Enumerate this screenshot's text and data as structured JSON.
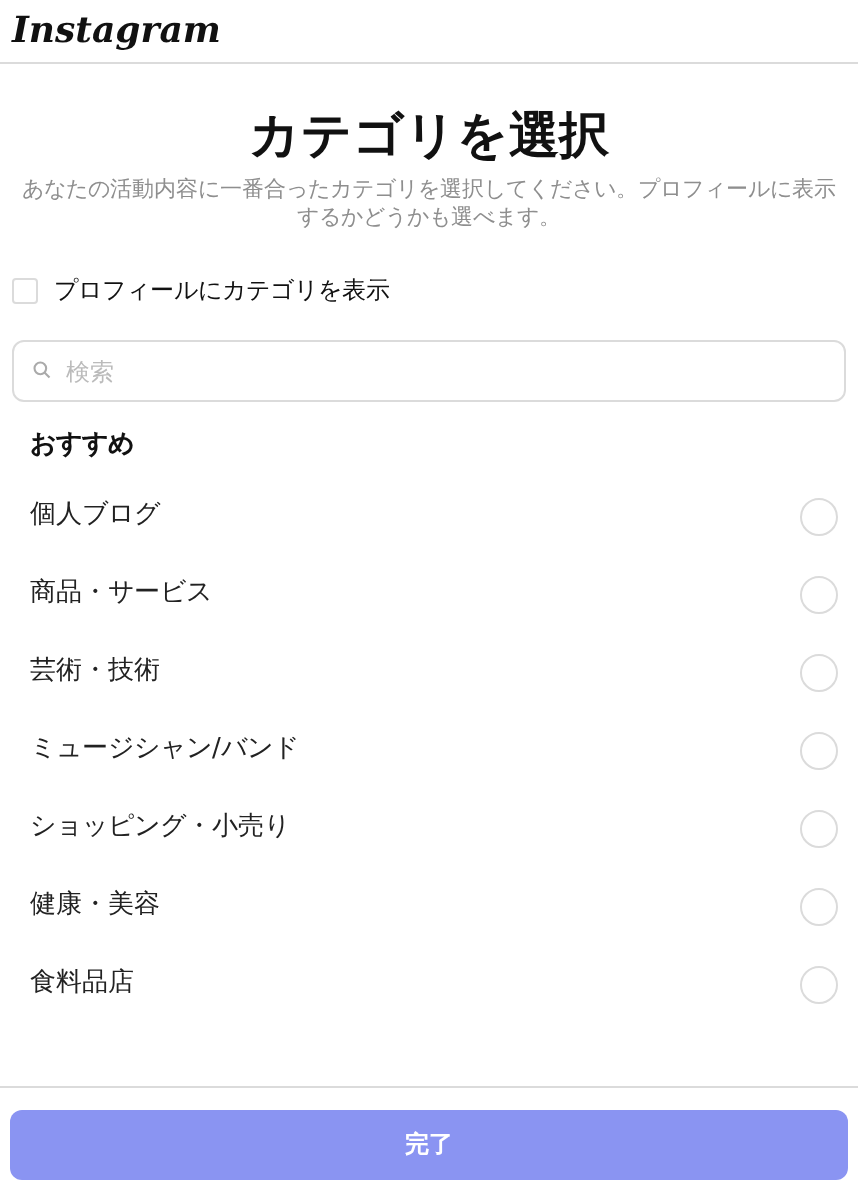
{
  "header": {
    "logo": "Instagram"
  },
  "title": "カテゴリを選択",
  "subtitle": "あなたの活動内容に一番合ったカテゴリを選択してください。プロフィールに表示するかどうかも選べます。",
  "show_on_profile": {
    "label": "プロフィールにカテゴリを表示",
    "checked": false
  },
  "search": {
    "placeholder": "検索"
  },
  "section_heading": "おすすめ",
  "categories": [
    {
      "label": "個人ブログ",
      "selected": false
    },
    {
      "label": "商品・サービス",
      "selected": false
    },
    {
      "label": "芸術・技術",
      "selected": false
    },
    {
      "label": "ミュージシャン/バンド",
      "selected": false
    },
    {
      "label": "ショッピング・小売り",
      "selected": false
    },
    {
      "label": "健康・美容",
      "selected": false
    },
    {
      "label": "食料品店",
      "selected": false
    }
  ],
  "done_button": {
    "label": "完了",
    "disabled": true
  }
}
